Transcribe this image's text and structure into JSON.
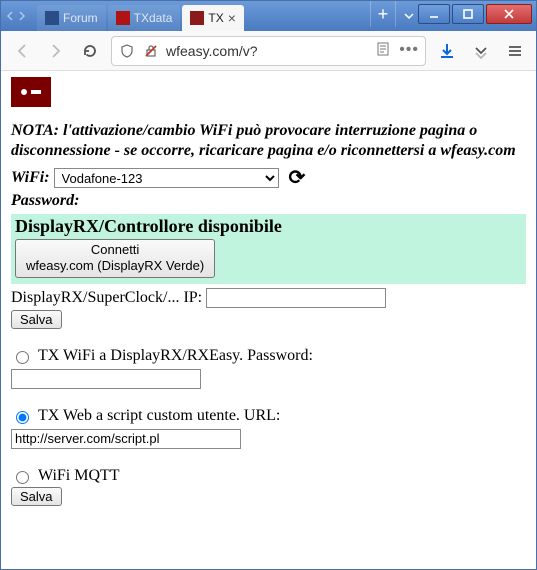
{
  "window": {
    "tabs": [
      {
        "label": "Forum",
        "favicon_bg": "#2a4d85"
      },
      {
        "label": "TXdata",
        "favicon_bg": "#b01313"
      },
      {
        "label": "TX",
        "favicon_bg": "#8b1a1a",
        "active": true
      }
    ]
  },
  "toolbar": {
    "url": "wfeasy.com/v?"
  },
  "page": {
    "nota": "NOTA: l'attivazione/cambio WiFi può provocare interruzione pagina o disconnessione - se occorre, ricaricare pagina e/o riconnettersi a wfeasy.com",
    "wifi_label": "WiFi:",
    "wifi_value": "Vodafone-123",
    "password_label": "Password:",
    "green_title": "DisplayRX/Controllore disponibile",
    "connect_btn_line1": "Connetti",
    "connect_btn_line2": "wfeasy.com (DisplayRX Verde)",
    "ip_label": "DisplayRX/SuperClock/... IP:",
    "salva": "Salva",
    "radio1_label": "TX WiFi a DisplayRX/RXEasy. Password:",
    "radio2_label": "TX Web a script custom utente. URL:",
    "url_value": "http://server.com/script.pl",
    "radio3_label": "WiFi MQTT"
  }
}
